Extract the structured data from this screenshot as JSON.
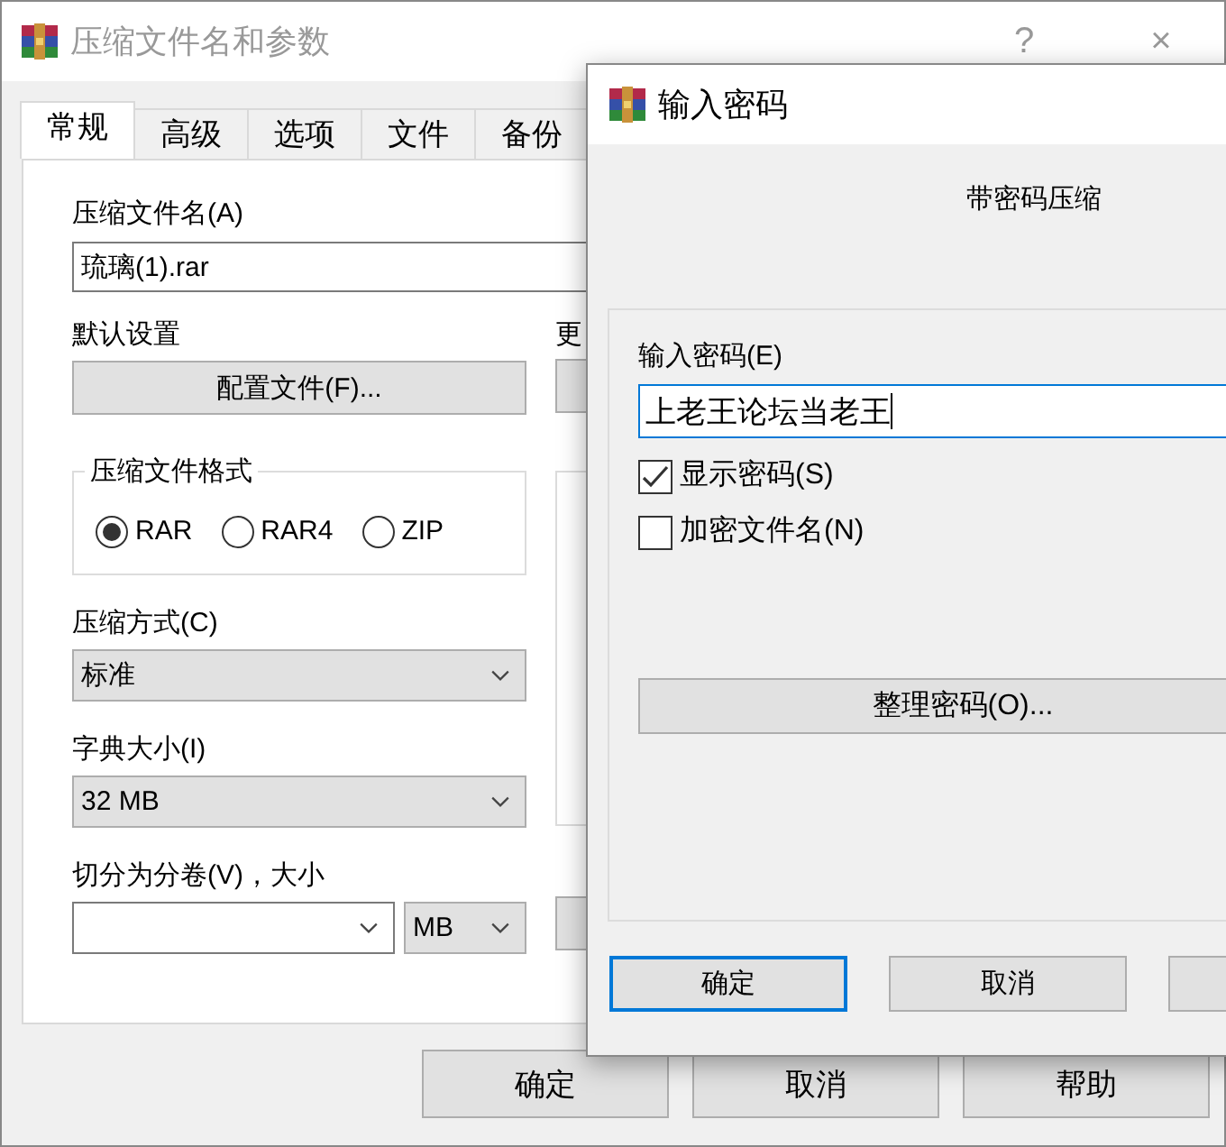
{
  "main_window": {
    "title": "压缩文件名和参数",
    "help": "?",
    "close": "×",
    "tabs": [
      {
        "label": "常规",
        "selected": true
      },
      {
        "label": "高级",
        "selected": false
      },
      {
        "label": "选项",
        "selected": false
      },
      {
        "label": "文件",
        "selected": false
      },
      {
        "label": "备份",
        "selected": false
      }
    ],
    "archive_name": {
      "label": "压缩文件名(A)",
      "value": "琉璃(1).rar"
    },
    "default_settings": {
      "label": "默认设置",
      "button": "配置文件(F)..."
    },
    "update_label": "更",
    "format_group": {
      "title": "压缩文件格式",
      "options": [
        {
          "label": "RAR",
          "selected": true
        },
        {
          "label": "RAR4",
          "selected": false
        },
        {
          "label": "ZIP",
          "selected": false
        }
      ]
    },
    "method": {
      "label": "压缩方式(C)",
      "value": "标准"
    },
    "dictionary": {
      "label": "字典大小(I)",
      "value": "32 MB"
    },
    "split": {
      "label": "切分为分卷(V)，大小",
      "unit": "MB"
    },
    "buttons": [
      "确定",
      "取消",
      "帮助"
    ]
  },
  "password_dialog": {
    "title": "输入密码",
    "heading": "带密码压缩",
    "password": {
      "label": "输入密码(E)",
      "value": "上老王论坛当老王"
    },
    "checkboxes": [
      {
        "label": "显示密码(S)",
        "checked": true
      },
      {
        "label": "加密文件名(N)",
        "checked": false
      }
    ],
    "organize_button": "整理密码(O)...",
    "buttons": [
      {
        "label": "确定",
        "default": true
      },
      {
        "label": "取消",
        "default": false
      }
    ]
  }
}
